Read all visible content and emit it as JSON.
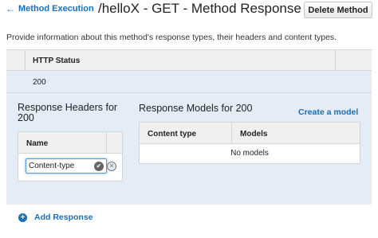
{
  "header": {
    "back_label": "Method Execution",
    "title": "/helloX - GET - Method Response",
    "delete_label": "Delete Method"
  },
  "description": "Provide information about this method's response types, their headers and content types.",
  "status_table": {
    "column": "HTTP Status",
    "rows": [
      {
        "status": "200"
      }
    ]
  },
  "response_headers": {
    "title": "Response Headers for 200",
    "column": "Name",
    "input_value": "Content-type"
  },
  "response_models": {
    "title": "Response Models for 200",
    "create_label": "Create a model",
    "columns": [
      "Content type",
      "Models"
    ],
    "empty_text": "No models"
  },
  "add_response_label": "Add Response",
  "colors": {
    "link": "#1a6fb5",
    "selected_row": "#e4edf7"
  },
  "icons": {
    "back": "arrow-left-icon",
    "ok": "check-circle-icon",
    "cancel": "close-circle-icon",
    "add": "plus-circle-icon"
  }
}
